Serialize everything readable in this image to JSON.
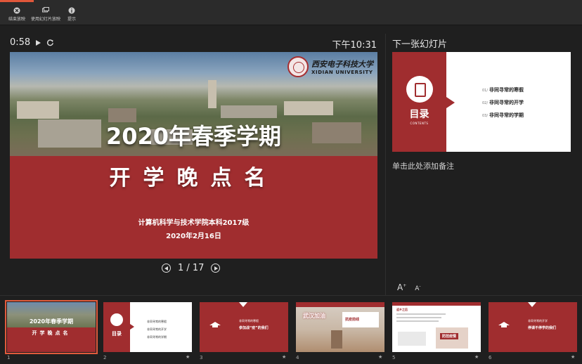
{
  "toolbar": {
    "end_show": "结束放映",
    "use_slideshow": "使用幻灯片放映",
    "hint": "提示"
  },
  "presenter": {
    "timer": "0:58",
    "clock": "下午10:31",
    "page_indicator": "1 / 17"
  },
  "current_slide": {
    "logo_cn": "西安电子科技大学",
    "logo_en": "XIDIAN UNIVERSITY",
    "title": "2020年春季学期",
    "subtitle": "开学晚点名",
    "college": "计算机科学与技术学院本科2017级",
    "date": "2020年2月16日"
  },
  "next_panel": {
    "label": "下一张幻灯片",
    "contents_cn": "目录",
    "contents_en": "CONTENTS",
    "items": [
      {
        "num": "01/",
        "text": "非同寻常的寒假"
      },
      {
        "num": "02/",
        "text": "非同寻常的开学"
      },
      {
        "num": "03/",
        "text": "非同寻常的学期"
      }
    ]
  },
  "notes": {
    "placeholder": "单击此处添加备注",
    "font_up": "A",
    "font_down": "A"
  },
  "thumbnails": [
    {
      "num": "1",
      "title": "2020年春季学期",
      "subtitle": "开学晚点名"
    },
    {
      "num": "2",
      "title": "目录",
      "items": [
        "非同寻常的寒假",
        "非同寻常的开学",
        "非同寻常的学期"
      ]
    },
    {
      "num": "3",
      "title": "参加战“疫”的我们",
      "small": "非同寻常的寒假"
    },
    {
      "num": "4",
      "title": "武汉加油",
      "quote": "抗疫前线"
    },
    {
      "num": "5",
      "title": "防控疫情",
      "small": "返乡之后"
    },
    {
      "num": "6",
      "title": "停课不停学的我们",
      "small": "非同寻常的开学"
    }
  ],
  "colors": {
    "accent": "#e0573a",
    "brand_red": "#a02d2f",
    "background": "#1f1f1f"
  }
}
